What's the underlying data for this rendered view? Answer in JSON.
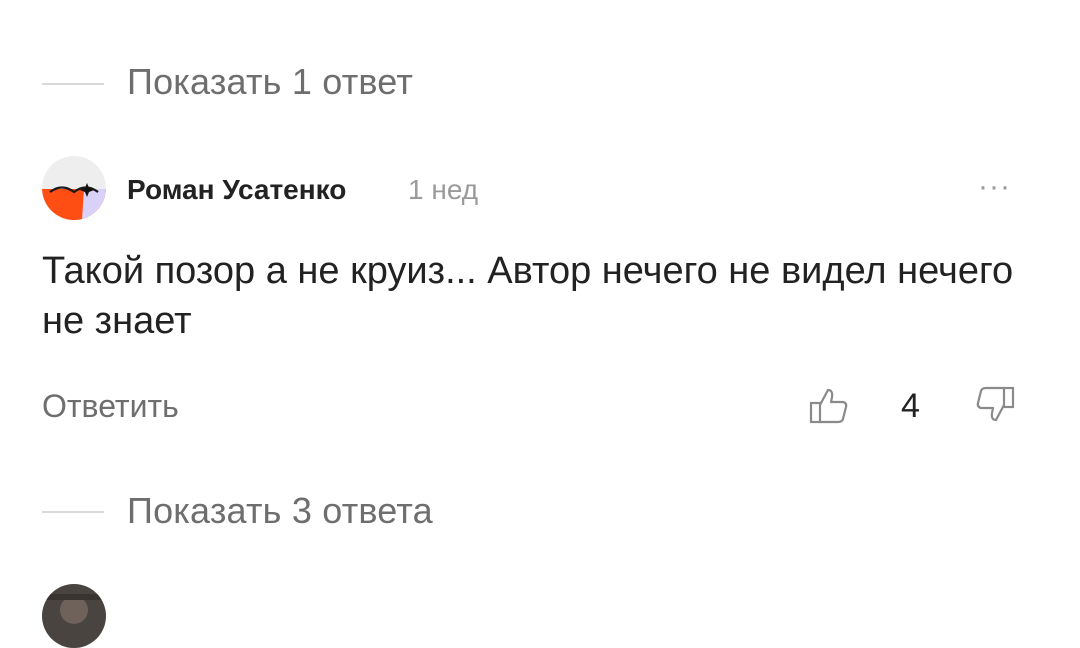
{
  "thread1": {
    "show_replies": "Показать 1 ответ"
  },
  "comment": {
    "author": "Роман Усатенко",
    "time": "1 нед",
    "more": "···",
    "text": "Такой позор а не круиз... Автор нечего не видел нечего не знает",
    "reply_label": "Ответить",
    "likes": "4"
  },
  "thread2": {
    "show_replies": "Показать 3 ответа"
  },
  "icons": {
    "avatar": "avatar-user",
    "more": "more-horizontal-icon",
    "like": "thumbs-up-icon",
    "dislike": "thumbs-down-icon"
  },
  "colors": {
    "avatar_orange": "#ff4e14",
    "avatar_lavender": "#d9d1f7",
    "avatar_light": "#eeeeee",
    "muted_text": "#6e6e6e",
    "icon_gray": "#8a8a8a"
  }
}
